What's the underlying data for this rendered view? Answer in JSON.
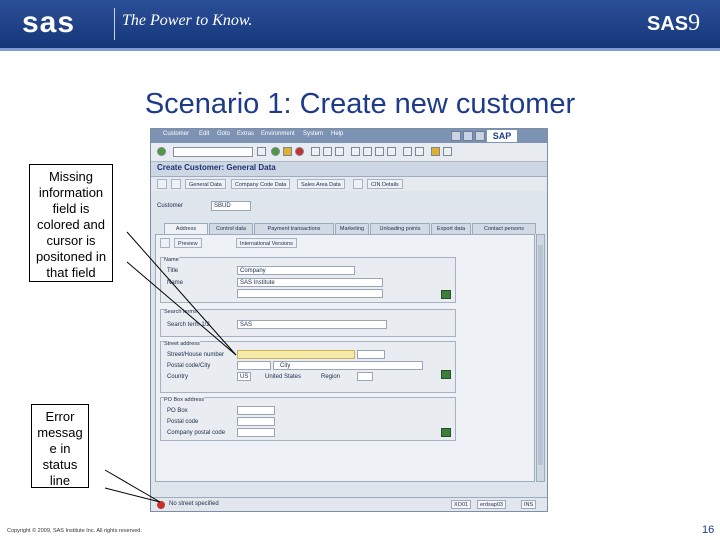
{
  "header": {
    "logo": "sas",
    "tagline": "The Power to Know.",
    "badge": "SAS",
    "badge_num": "9"
  },
  "slide": {
    "title": "Scenario 1: Create new customer",
    "footer": "Copyright © 2009, SAS Institute Inc. All rights reserved.",
    "page_number": "16"
  },
  "callouts": {
    "missing_field": "Missing information field is colored and cursor is positoned in that field",
    "error_message": "Error messag e in status line"
  },
  "sap": {
    "menu": [
      "Customer",
      "Edit",
      "Goto",
      "Extras",
      "Environment",
      "System",
      "Help"
    ],
    "logo": "SAP",
    "screen_title": "Create Customer: General Data",
    "app_toolbar": [
      "General Data",
      "Company Code Data",
      "Sales Area Data",
      "CIN Details"
    ],
    "customer": {
      "label": "Customer",
      "value": "SBUD"
    },
    "tabs": [
      "Address",
      "Control data",
      "Payment transactions",
      "Marketing",
      "Unloading points",
      "Export data",
      "Contact persons"
    ],
    "panel_toolbar": {
      "preview": "Preview",
      "intl_versions": "International Versions"
    },
    "name_group": {
      "title": "Name",
      "title_label": "Title",
      "title_value": "Company",
      "name_label": "Name",
      "name_value": "SAS Institute"
    },
    "search_group": {
      "title": "Search terms",
      "label": "Search term 1/2",
      "value": "SAS"
    },
    "street_group": {
      "title": "Street address",
      "street_label": "Street/House number",
      "postal_label": "Postal code/City",
      "city_label": "City",
      "country_label": "Country",
      "country_value": "US",
      "country_name": "United States",
      "region_label": "Region"
    },
    "pobox_group": {
      "title": "PO Box address",
      "pobox_label": "PO Box",
      "postal_label": "Postal code",
      "company_label": "Company postal code"
    },
    "status": {
      "message": "No street specified",
      "fields": [
        "XO01",
        "erdsap03",
        "INS"
      ]
    }
  },
  "colors": {
    "header_bg": "#1f3f8a",
    "title_blue": "#1d3a8b",
    "required_field": "#f7e9a8",
    "error_red": "#c8312c"
  }
}
